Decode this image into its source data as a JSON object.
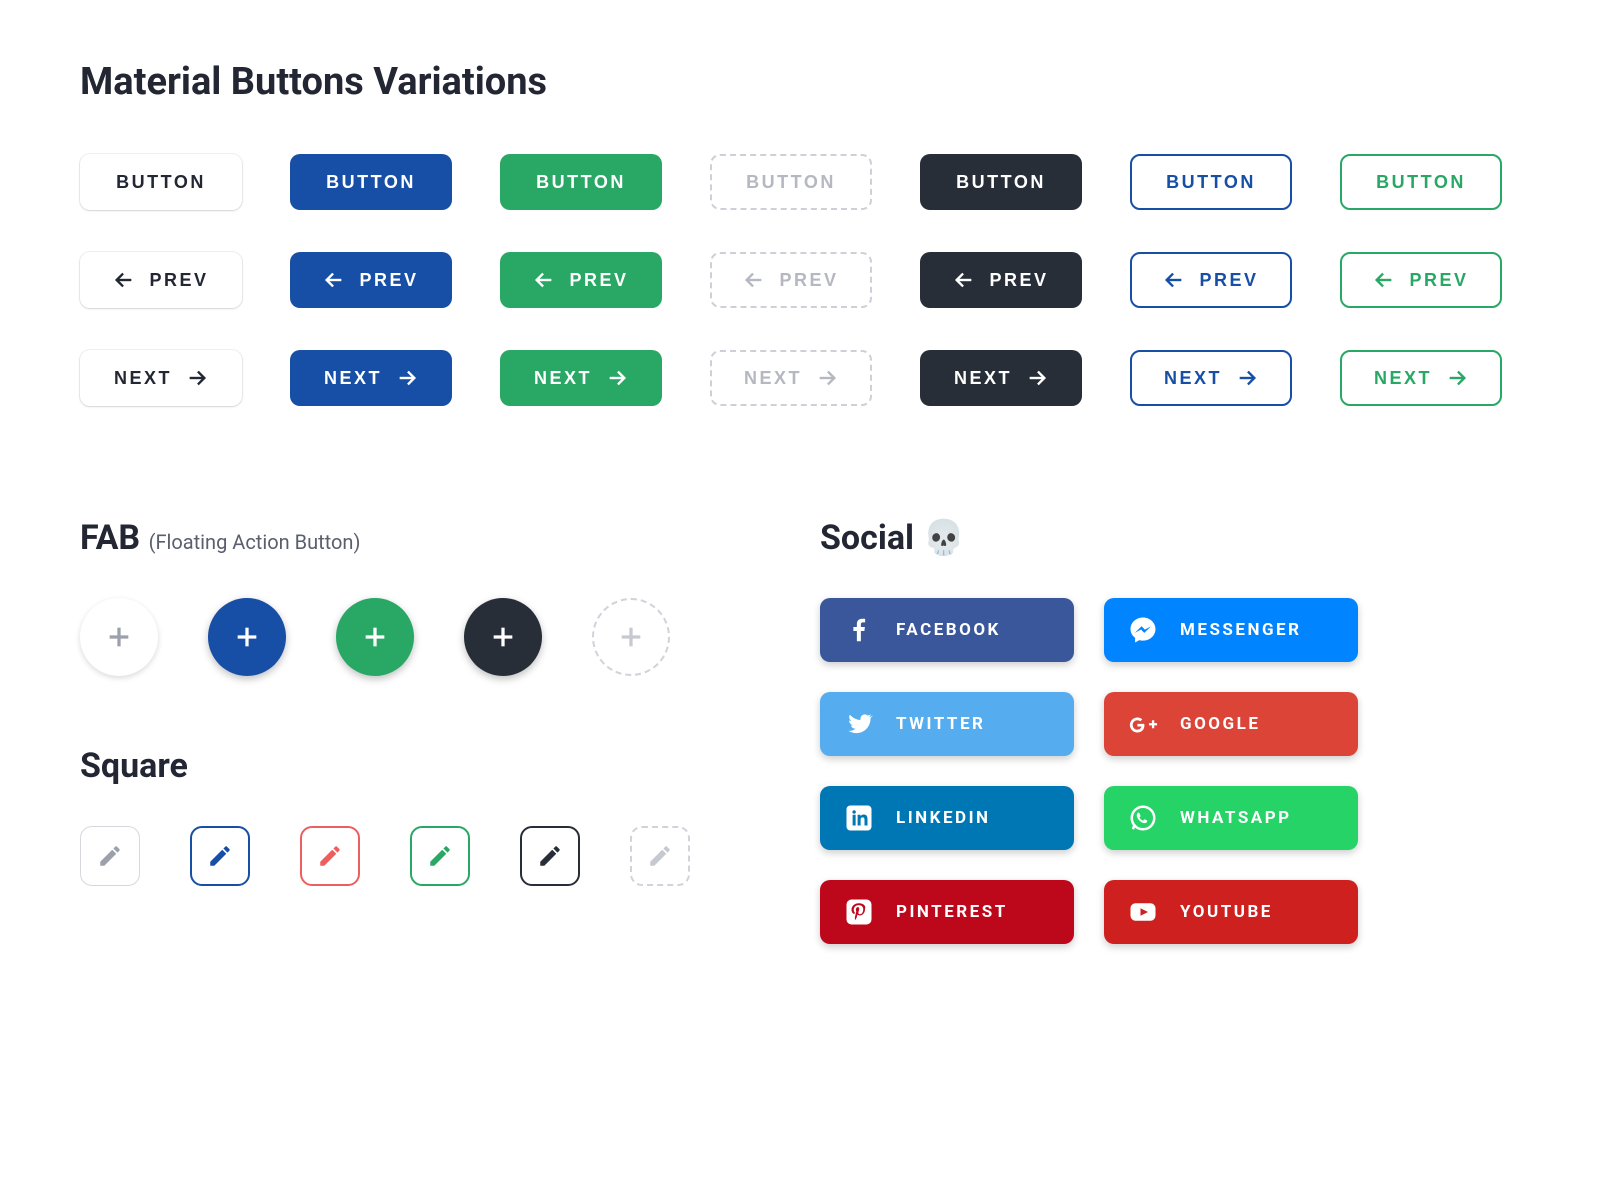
{
  "title": "Material Buttons Variations",
  "labels": {
    "button": "BUTTON",
    "prev": "PREV",
    "next": "NEXT"
  },
  "fab": {
    "title": "FAB",
    "subtitle": "(Floating Action Button)"
  },
  "square": {
    "title": "Square"
  },
  "social": {
    "title": "Social 💀",
    "items": {
      "facebook": "FACEBOOK",
      "messenger": "MESSENGER",
      "twitter": "TWITTER",
      "google": "GOOGLE",
      "linkedin": "LINKEDIN",
      "whatsapp": "WHATSAPP",
      "pinterest": "PINTEREST",
      "youtube": "YOUTUBE"
    }
  },
  "colors": {
    "primary": "#174EA6",
    "success": "#28A864",
    "dark": "#272E38",
    "muted": "#B5B8C0"
  }
}
